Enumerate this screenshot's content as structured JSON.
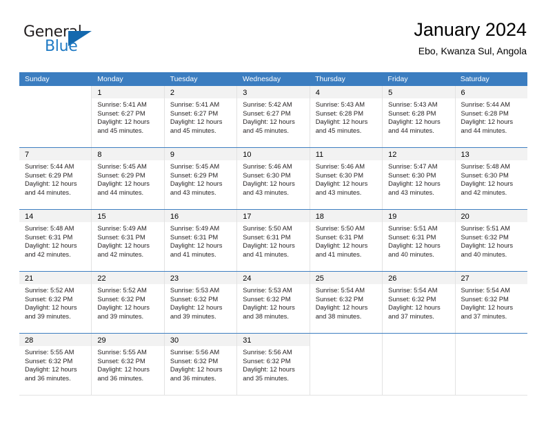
{
  "brand": {
    "name_primary": "General",
    "name_secondary": "Blue",
    "primary_color": "#231f20",
    "secondary_color": "#1f7ac4",
    "triangle_color": "#1569ae"
  },
  "header": {
    "title": "January 2024",
    "subtitle": "Ebo, Kwanza Sul, Angola"
  },
  "theme": {
    "header_row_bg": "#3b7dc0",
    "header_row_text": "#ffffff",
    "daynum_bg": "#f2f2f2",
    "cell_border": "#e2e2e2",
    "week_separator": "#3b7dc0"
  },
  "weekdays": [
    {
      "label": "Sunday"
    },
    {
      "label": "Monday"
    },
    {
      "label": "Tuesday"
    },
    {
      "label": "Wednesday"
    },
    {
      "label": "Thursday"
    },
    {
      "label": "Friday"
    },
    {
      "label": "Saturday"
    }
  ],
  "weeks": [
    {
      "days": [
        {
          "empty": true,
          "day": "",
          "l1": "",
          "l2": "",
          "l3": "",
          "l4": ""
        },
        {
          "empty": false,
          "day": "1",
          "l1": "Sunrise: 5:41 AM",
          "l2": "Sunset: 6:27 PM",
          "l3": "Daylight: 12 hours",
          "l4": "and 45 minutes."
        },
        {
          "empty": false,
          "day": "2",
          "l1": "Sunrise: 5:41 AM",
          "l2": "Sunset: 6:27 PM",
          "l3": "Daylight: 12 hours",
          "l4": "and 45 minutes."
        },
        {
          "empty": false,
          "day": "3",
          "l1": "Sunrise: 5:42 AM",
          "l2": "Sunset: 6:27 PM",
          "l3": "Daylight: 12 hours",
          "l4": "and 45 minutes."
        },
        {
          "empty": false,
          "day": "4",
          "l1": "Sunrise: 5:43 AM",
          "l2": "Sunset: 6:28 PM",
          "l3": "Daylight: 12 hours",
          "l4": "and 45 minutes."
        },
        {
          "empty": false,
          "day": "5",
          "l1": "Sunrise: 5:43 AM",
          "l2": "Sunset: 6:28 PM",
          "l3": "Daylight: 12 hours",
          "l4": "and 44 minutes."
        },
        {
          "empty": false,
          "day": "6",
          "l1": "Sunrise: 5:44 AM",
          "l2": "Sunset: 6:28 PM",
          "l3": "Daylight: 12 hours",
          "l4": "and 44 minutes."
        }
      ]
    },
    {
      "days": [
        {
          "empty": false,
          "day": "7",
          "l1": "Sunrise: 5:44 AM",
          "l2": "Sunset: 6:29 PM",
          "l3": "Daylight: 12 hours",
          "l4": "and 44 minutes."
        },
        {
          "empty": false,
          "day": "8",
          "l1": "Sunrise: 5:45 AM",
          "l2": "Sunset: 6:29 PM",
          "l3": "Daylight: 12 hours",
          "l4": "and 44 minutes."
        },
        {
          "empty": false,
          "day": "9",
          "l1": "Sunrise: 5:45 AM",
          "l2": "Sunset: 6:29 PM",
          "l3": "Daylight: 12 hours",
          "l4": "and 43 minutes."
        },
        {
          "empty": false,
          "day": "10",
          "l1": "Sunrise: 5:46 AM",
          "l2": "Sunset: 6:30 PM",
          "l3": "Daylight: 12 hours",
          "l4": "and 43 minutes."
        },
        {
          "empty": false,
          "day": "11",
          "l1": "Sunrise: 5:46 AM",
          "l2": "Sunset: 6:30 PM",
          "l3": "Daylight: 12 hours",
          "l4": "and 43 minutes."
        },
        {
          "empty": false,
          "day": "12",
          "l1": "Sunrise: 5:47 AM",
          "l2": "Sunset: 6:30 PM",
          "l3": "Daylight: 12 hours",
          "l4": "and 43 minutes."
        },
        {
          "empty": false,
          "day": "13",
          "l1": "Sunrise: 5:48 AM",
          "l2": "Sunset: 6:30 PM",
          "l3": "Daylight: 12 hours",
          "l4": "and 42 minutes."
        }
      ]
    },
    {
      "days": [
        {
          "empty": false,
          "day": "14",
          "l1": "Sunrise: 5:48 AM",
          "l2": "Sunset: 6:31 PM",
          "l3": "Daylight: 12 hours",
          "l4": "and 42 minutes."
        },
        {
          "empty": false,
          "day": "15",
          "l1": "Sunrise: 5:49 AM",
          "l2": "Sunset: 6:31 PM",
          "l3": "Daylight: 12 hours",
          "l4": "and 42 minutes."
        },
        {
          "empty": false,
          "day": "16",
          "l1": "Sunrise: 5:49 AM",
          "l2": "Sunset: 6:31 PM",
          "l3": "Daylight: 12 hours",
          "l4": "and 41 minutes."
        },
        {
          "empty": false,
          "day": "17",
          "l1": "Sunrise: 5:50 AM",
          "l2": "Sunset: 6:31 PM",
          "l3": "Daylight: 12 hours",
          "l4": "and 41 minutes."
        },
        {
          "empty": false,
          "day": "18",
          "l1": "Sunrise: 5:50 AM",
          "l2": "Sunset: 6:31 PM",
          "l3": "Daylight: 12 hours",
          "l4": "and 41 minutes."
        },
        {
          "empty": false,
          "day": "19",
          "l1": "Sunrise: 5:51 AM",
          "l2": "Sunset: 6:31 PM",
          "l3": "Daylight: 12 hours",
          "l4": "and 40 minutes."
        },
        {
          "empty": false,
          "day": "20",
          "l1": "Sunrise: 5:51 AM",
          "l2": "Sunset: 6:32 PM",
          "l3": "Daylight: 12 hours",
          "l4": "and 40 minutes."
        }
      ]
    },
    {
      "days": [
        {
          "empty": false,
          "day": "21",
          "l1": "Sunrise: 5:52 AM",
          "l2": "Sunset: 6:32 PM",
          "l3": "Daylight: 12 hours",
          "l4": "and 39 minutes."
        },
        {
          "empty": false,
          "day": "22",
          "l1": "Sunrise: 5:52 AM",
          "l2": "Sunset: 6:32 PM",
          "l3": "Daylight: 12 hours",
          "l4": "and 39 minutes."
        },
        {
          "empty": false,
          "day": "23",
          "l1": "Sunrise: 5:53 AM",
          "l2": "Sunset: 6:32 PM",
          "l3": "Daylight: 12 hours",
          "l4": "and 39 minutes."
        },
        {
          "empty": false,
          "day": "24",
          "l1": "Sunrise: 5:53 AM",
          "l2": "Sunset: 6:32 PM",
          "l3": "Daylight: 12 hours",
          "l4": "and 38 minutes."
        },
        {
          "empty": false,
          "day": "25",
          "l1": "Sunrise: 5:54 AM",
          "l2": "Sunset: 6:32 PM",
          "l3": "Daylight: 12 hours",
          "l4": "and 38 minutes."
        },
        {
          "empty": false,
          "day": "26",
          "l1": "Sunrise: 5:54 AM",
          "l2": "Sunset: 6:32 PM",
          "l3": "Daylight: 12 hours",
          "l4": "and 37 minutes."
        },
        {
          "empty": false,
          "day": "27",
          "l1": "Sunrise: 5:54 AM",
          "l2": "Sunset: 6:32 PM",
          "l3": "Daylight: 12 hours",
          "l4": "and 37 minutes."
        }
      ]
    },
    {
      "days": [
        {
          "empty": false,
          "day": "28",
          "l1": "Sunrise: 5:55 AM",
          "l2": "Sunset: 6:32 PM",
          "l3": "Daylight: 12 hours",
          "l4": "and 36 minutes."
        },
        {
          "empty": false,
          "day": "29",
          "l1": "Sunrise: 5:55 AM",
          "l2": "Sunset: 6:32 PM",
          "l3": "Daylight: 12 hours",
          "l4": "and 36 minutes."
        },
        {
          "empty": false,
          "day": "30",
          "l1": "Sunrise: 5:56 AM",
          "l2": "Sunset: 6:32 PM",
          "l3": "Daylight: 12 hours",
          "l4": "and 36 minutes."
        },
        {
          "empty": false,
          "day": "31",
          "l1": "Sunrise: 5:56 AM",
          "l2": "Sunset: 6:32 PM",
          "l3": "Daylight: 12 hours",
          "l4": "and 35 minutes."
        },
        {
          "empty": true,
          "day": "",
          "l1": "",
          "l2": "",
          "l3": "",
          "l4": ""
        },
        {
          "empty": true,
          "day": "",
          "l1": "",
          "l2": "",
          "l3": "",
          "l4": ""
        },
        {
          "empty": true,
          "day": "",
          "l1": "",
          "l2": "",
          "l3": "",
          "l4": ""
        }
      ]
    }
  ]
}
